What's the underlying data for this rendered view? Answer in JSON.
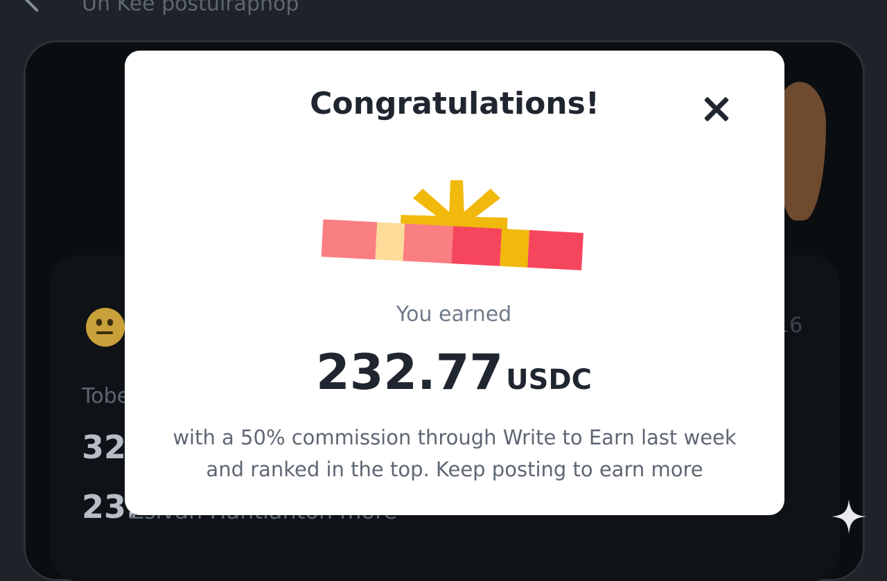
{
  "header": {
    "back_icon": "chevron-left-icon",
    "title": "Uh Kee postulraphop"
  },
  "background_post": {
    "date_fragment": "16",
    "label_fragment": "Tobe",
    "number_1_fragment": "32",
    "number_2_fragment": "23.",
    "faded_text": "Zsivan Hantianton more"
  },
  "modal": {
    "title": "Congratulations!",
    "close_icon": "close-icon",
    "gift_icon": "gift-icon",
    "earned_label": "You earned",
    "amount": "232.77",
    "currency": "USDC",
    "description": "with a 50% commission through Write to Earn last week and ranked in the top. Keep posting to earn more"
  },
  "colors": {
    "background": "#1e2329",
    "modal_bg": "#ffffff",
    "gift_ribbon": "#f0b90b",
    "gift_red": "#f6465d",
    "gift_pink": "#fa7f83",
    "gift_cream": "#fddc9a"
  }
}
